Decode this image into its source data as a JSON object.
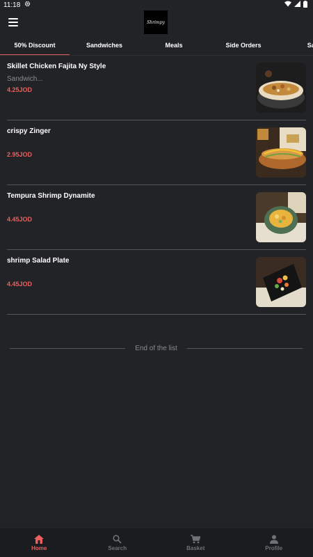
{
  "status_bar": {
    "time": "11:18"
  },
  "header": {
    "logo_text": "Shrimpy"
  },
  "tabs": [
    {
      "label": "50% Discount",
      "active": true
    },
    {
      "label": "Sandwiches",
      "active": false
    },
    {
      "label": "Meals",
      "active": false
    },
    {
      "label": "Side Orders",
      "active": false
    },
    {
      "label": "Sau",
      "active": false
    }
  ],
  "items": [
    {
      "title": "Skillet Chicken Fajita Ny Style",
      "subtitle": "Sandwich...",
      "price": "4.25JOD"
    },
    {
      "title": "crispy Zinger",
      "subtitle": "",
      "price": "2.95JOD"
    },
    {
      "title": "Tempura Shrimp Dynamite",
      "subtitle": "",
      "price": "4.45JOD"
    },
    {
      "title": "shrimp Salad Plate",
      "subtitle": "",
      "price": "4.45JOD"
    }
  ],
  "end_of_list": "End of the list",
  "bottom_nav": [
    {
      "label": "Home",
      "icon": "home-icon",
      "active": true
    },
    {
      "label": "Search",
      "icon": "search-icon",
      "active": false
    },
    {
      "label": "Basket",
      "icon": "cart-icon",
      "active": false
    },
    {
      "label": "Profile",
      "icon": "person-icon",
      "active": false
    }
  ],
  "colors": {
    "background": "#222326",
    "accent": "#e86060",
    "nav_background": "#1b1c1f",
    "divider": "#55575c"
  }
}
